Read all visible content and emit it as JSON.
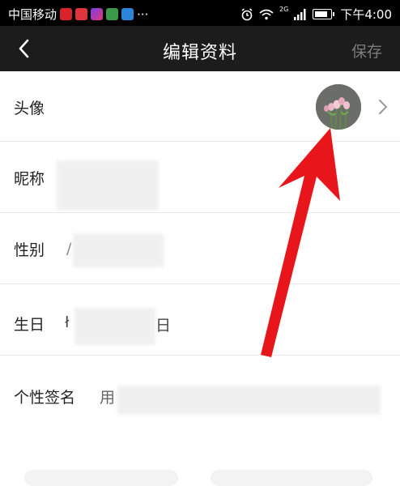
{
  "status_bar": {
    "carrier": "中国移动",
    "network": "2G",
    "time": "下午4:00",
    "more": "···"
  },
  "nav": {
    "title": "编辑资料",
    "save_label": "保存"
  },
  "profile": {
    "avatar_label": "头像",
    "nickname_label": "昵称",
    "gender_label": "性别",
    "gender_value_partial": "/",
    "birthday_label": "生日",
    "birthday_value_start": "ł",
    "birthday_value_end": "日",
    "signature_label": "个性签名",
    "signature_value_partial": "用"
  },
  "colors": {
    "nav_bg": "#1c1c1c",
    "status_bg": "#000000",
    "annotation_arrow": "#e8151b",
    "save_disabled": "#7d7d7d"
  }
}
